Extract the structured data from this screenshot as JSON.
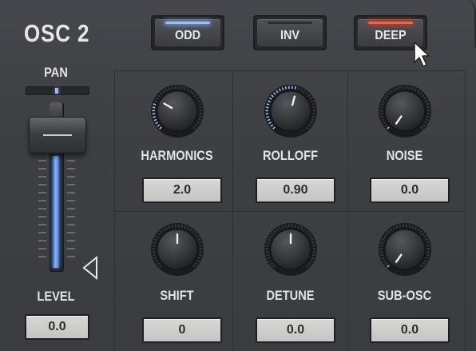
{
  "panel": {
    "title": "OSC 2"
  },
  "buttons": [
    {
      "id": "odd",
      "label": "ODD",
      "active": true,
      "led_color": "#6a8fd0"
    },
    {
      "id": "inv",
      "label": "INV",
      "active": false
    },
    {
      "id": "deep",
      "label": "DEEP",
      "active": true,
      "led_color": "#c23d25"
    }
  ],
  "pan": {
    "label": "PAN",
    "value": 0.5
  },
  "level": {
    "label": "LEVEL",
    "value": "0.0",
    "fill_fraction": 0.68
  },
  "knobs": [
    {
      "label": "HARMONICS",
      "value": "2.0",
      "angle": -60,
      "arc": 0.23
    },
    {
      "label": "ROLLOFF",
      "value": "0.90",
      "angle": 15,
      "arc": 0.55
    },
    {
      "label": "NOISE",
      "value": "0.0",
      "angle": -145,
      "arc": 0.0
    },
    {
      "label": "SHIFT",
      "value": "0",
      "angle": 0,
      "arc": 0.0
    },
    {
      "label": "DETUNE",
      "value": "0.0",
      "angle": 0,
      "arc": 0.0
    },
    {
      "label": "SUB-OSC",
      "value": "0.0",
      "angle": -145,
      "arc": 0.0
    }
  ],
  "colors": {
    "accent": "#6a8fd0",
    "deep_led": "#c23d25",
    "panel": "#3d3f43"
  }
}
